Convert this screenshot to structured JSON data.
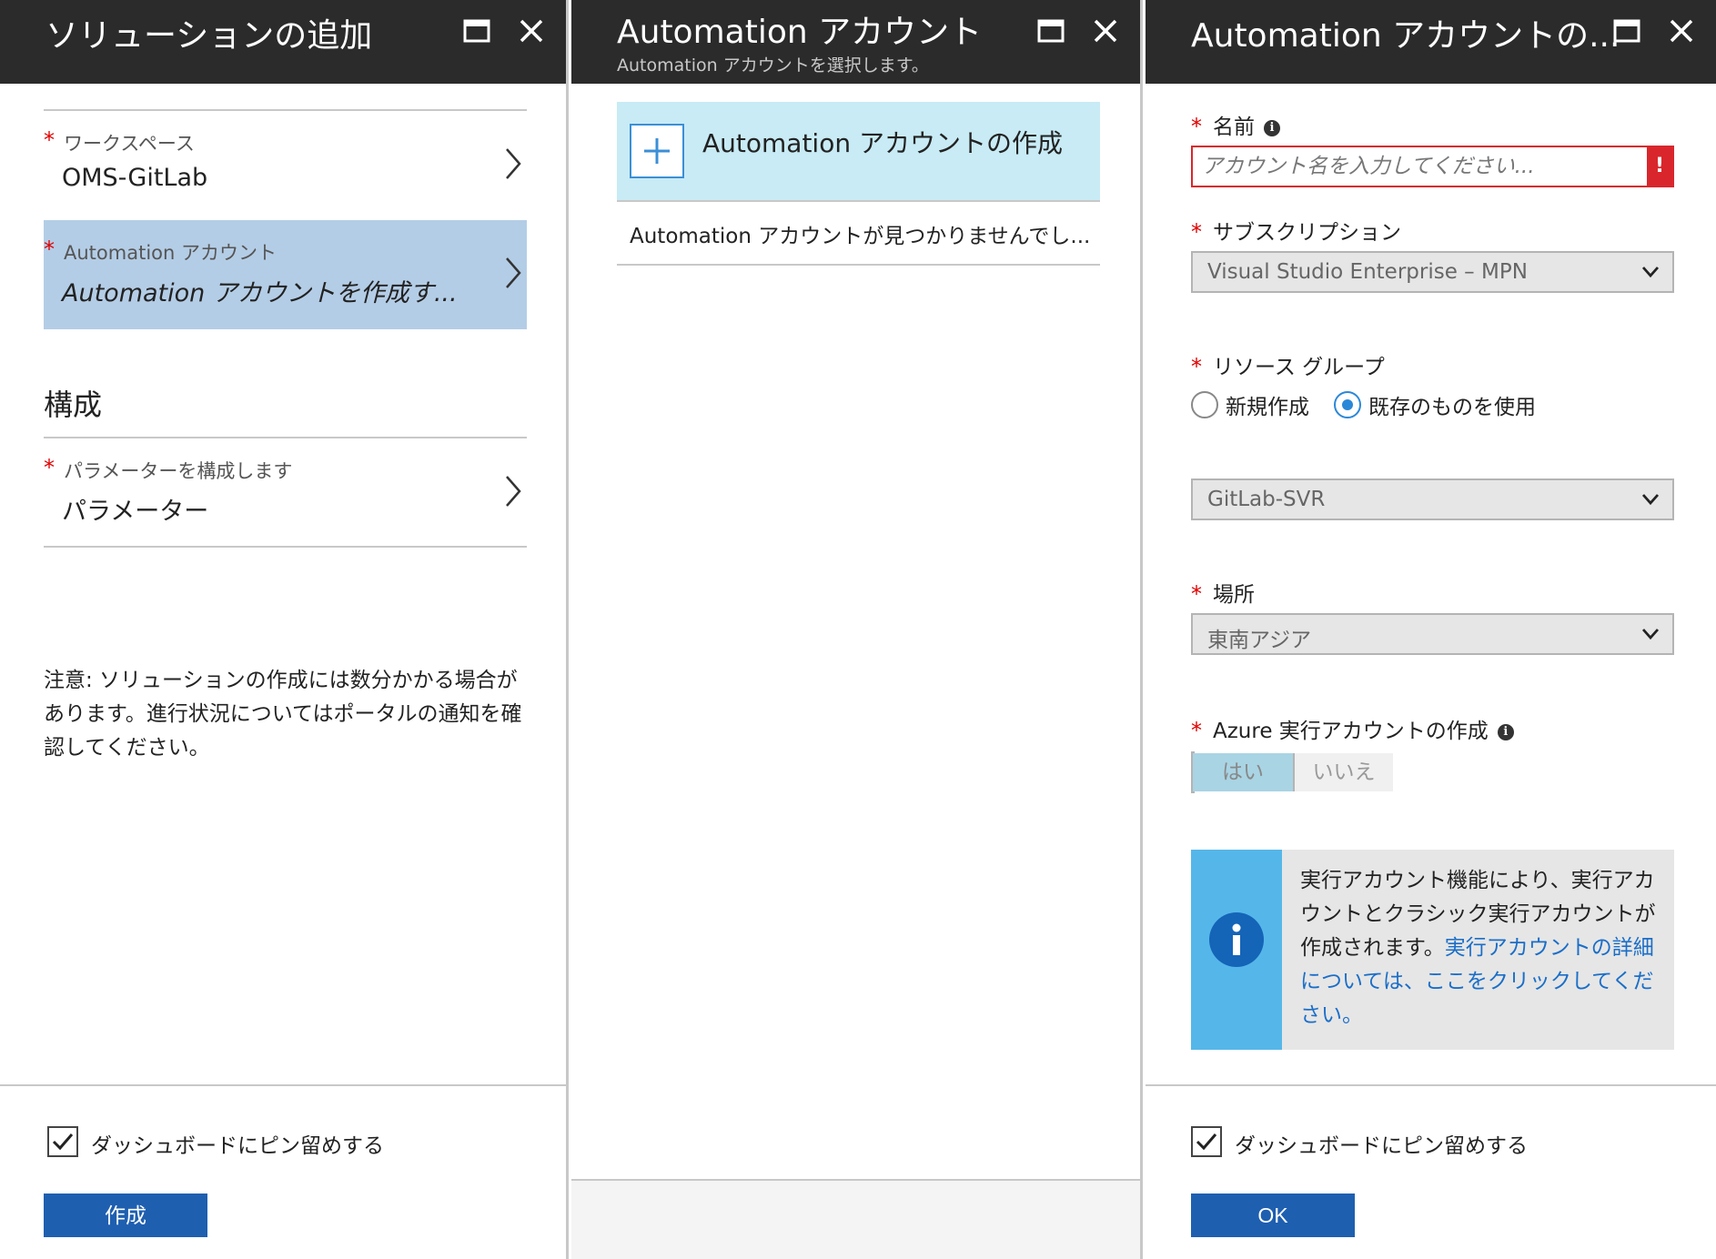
{
  "blade1": {
    "title": "ソリューションの追加",
    "workspace": {
      "label": "ワークスペース",
      "value": "OMS-GitLab"
    },
    "automation": {
      "label": "Automation アカウント",
      "value": "Automation アカウントを作成す..."
    },
    "section_title": "構成",
    "params": {
      "label": "パラメーターを構成します",
      "value": "パラメーター"
    },
    "note": "注意: ソリューションの作成には数分かかる場合があります。進行状況についてはポータルの通知を確認してください。",
    "pin_label": "ダッシュボードにピン留めする",
    "pin_checked": true,
    "create_button": "作成"
  },
  "blade2": {
    "title": "Automation アカウント",
    "subtitle": "Automation アカウントを選択します。",
    "create_tile": "Automation アカウントの作成",
    "empty_message": "Automation アカウントが見つかりませんでし..."
  },
  "blade3": {
    "title": "Automation アカウントの...",
    "name": {
      "label": "名前",
      "placeholder": "アカウント名を入力してください...",
      "value": "",
      "error_mark": "!"
    },
    "subscription": {
      "label": "サブスクリプション",
      "value": "Visual Studio Enterprise – MPN"
    },
    "resource_group": {
      "label": "リソース グループ",
      "options": [
        "新規作成",
        "既存のものを使用"
      ],
      "selected": "既存のものを使用",
      "value": "GitLab-SVR"
    },
    "location": {
      "label": "場所",
      "value": "東南アジア"
    },
    "run_as": {
      "label": "Azure 実行アカウントの作成",
      "yes": "はい",
      "no": "いいえ",
      "selected": "はい"
    },
    "info": {
      "text": "実行アカウント機能により、実行アカウントとクラシック実行アカウントが作成されます。",
      "link": "実行アカウントの詳細については、ここをクリックしてください。"
    },
    "pin_label": "ダッシュボードにピン留めする",
    "pin_checked": true,
    "ok_button": "OK"
  },
  "header_icons": [
    "maximize-icon",
    "close-icon"
  ],
  "colors": {
    "header_bg": "#2b2b2b",
    "selected_row": "#b4cde6",
    "create_tile": "#c8ebf5",
    "primary_button": "#1e5fb0",
    "error": "#d9262c",
    "info_strip": "#55b7e9",
    "link": "#1a6ec8"
  }
}
